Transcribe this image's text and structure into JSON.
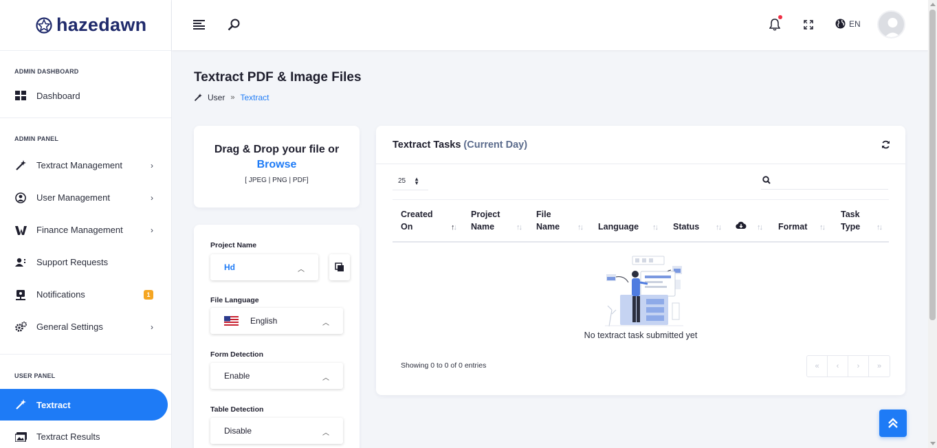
{
  "brand": {
    "name": "hazedawn"
  },
  "sidebar": {
    "sections": [
      {
        "title": "ADMIN DASHBOARD"
      },
      {
        "title": "ADMIN PANEL"
      },
      {
        "title": "USER PANEL"
      }
    ],
    "items": [
      {
        "label": "Dashboard",
        "icon": "dashboard-icon"
      },
      {
        "label": "Textract Management",
        "icon": "magic-wand-icon"
      },
      {
        "label": "User Management",
        "icon": "user-icon"
      },
      {
        "label": "Finance Management",
        "icon": "finance-icon"
      },
      {
        "label": "Support Requests",
        "icon": "support-icon"
      },
      {
        "label": "Notifications",
        "icon": "notification-icon",
        "badge": "1"
      },
      {
        "label": "General Settings",
        "icon": "gears-icon"
      },
      {
        "label": "Textract",
        "icon": "magic-wand-icon",
        "active": true
      },
      {
        "label": "Textract Results",
        "icon": "images-icon"
      }
    ]
  },
  "topbar": {
    "language": "EN"
  },
  "page": {
    "title": "Textract PDF & Image Files",
    "breadcrumb": {
      "parent": "User",
      "current": "Textract"
    }
  },
  "upload": {
    "title": "Drag & Drop your file or",
    "browse": "Browse",
    "types": "[ JPEG | PNG | PDF]"
  },
  "form": {
    "project_label": "Project Name",
    "project_value": "Hd",
    "language_label": "File Language",
    "language_value": "English",
    "form_detection_label": "Form Detection",
    "form_detection_value": "Enable",
    "table_detection_label": "Table Detection",
    "table_detection_value": "Disable"
  },
  "tasks": {
    "title": "Textract Tasks",
    "subtitle": "(Current Day)",
    "per_page": "25",
    "columns": [
      "Created On",
      "Project Name",
      "File Name",
      "Language",
      "Status",
      "",
      "Format",
      "Task Type"
    ],
    "empty_text": "No textract task submitted yet",
    "showing": "Showing 0 to 0 of 0 entries",
    "pager": [
      "«",
      "‹",
      "›",
      "»"
    ]
  },
  "colors": {
    "accent": "#1e7bf6",
    "brand": "#1f2a6b",
    "badge": "#f5a623",
    "notif_dot": "#ef2f44"
  }
}
